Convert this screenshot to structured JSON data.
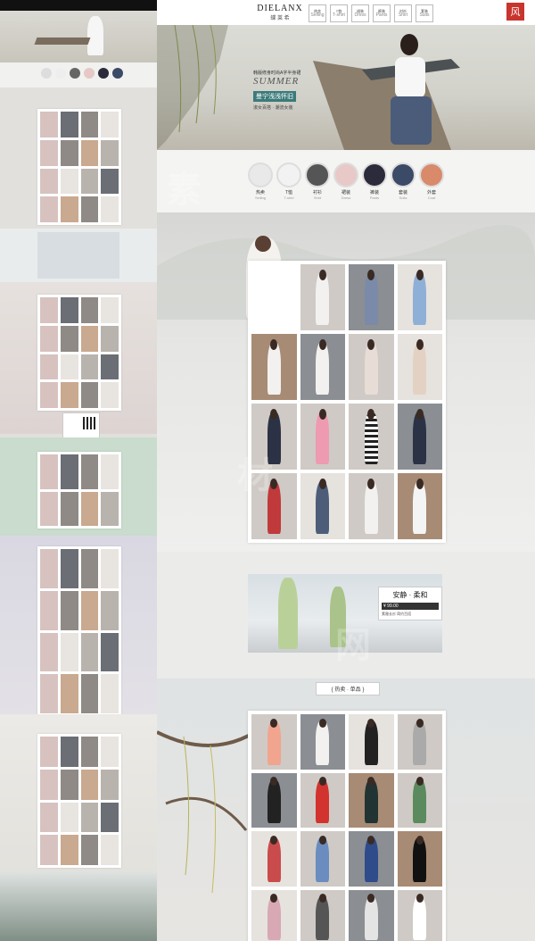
{
  "brand": {
    "name": "DIELANX",
    "subtitle": "蝶 莱 希",
    "seal": "风"
  },
  "nav": [
    {
      "label": "Selling",
      "sub": "热卖"
    },
    {
      "label": "T恤",
      "sub": "T-shirt"
    },
    {
      "label": "裙装",
      "sub": "Dress"
    },
    {
      "label": "裤装",
      "sub": "Pants"
    },
    {
      "label": "衬衫",
      "sub": "Shirt"
    },
    {
      "label": "套装",
      "sub": "Suits"
    }
  ],
  "hero": {
    "line1": "韩版修身时尚A字半身裙",
    "line2": "SUMMER",
    "line3": "曼宁浅浅怀旧",
    "line4": "淑女百搭 · 潮流女装"
  },
  "swatches": [
    {
      "label": "热卖",
      "sub": "Selling",
      "color": "#e9e9e9"
    },
    {
      "label": "T恤",
      "sub": "T-shirt",
      "color": "#f2f2f2"
    },
    {
      "label": "衬衫",
      "sub": "Shirt",
      "color": "#555555"
    },
    {
      "label": "裙装",
      "sub": "Dress",
      "color": "#e8c9c7"
    },
    {
      "label": "裤装",
      "sub": "Pants",
      "color": "#2b2b3b"
    },
    {
      "label": "套装",
      "sub": "Suits",
      "color": "#3b4a66"
    },
    {
      "label": "外套",
      "sub": "Coat",
      "color": "#d98a6a"
    }
  ],
  "banner2": {
    "title": "安静 · 柔和",
    "price": "¥ 99.00",
    "desc": "素雅长衫 简约百搭"
  },
  "section3": {
    "title": "{ 热卖 · 单品 }"
  },
  "watermarks": [
    "素",
    "材",
    "网"
  ]
}
